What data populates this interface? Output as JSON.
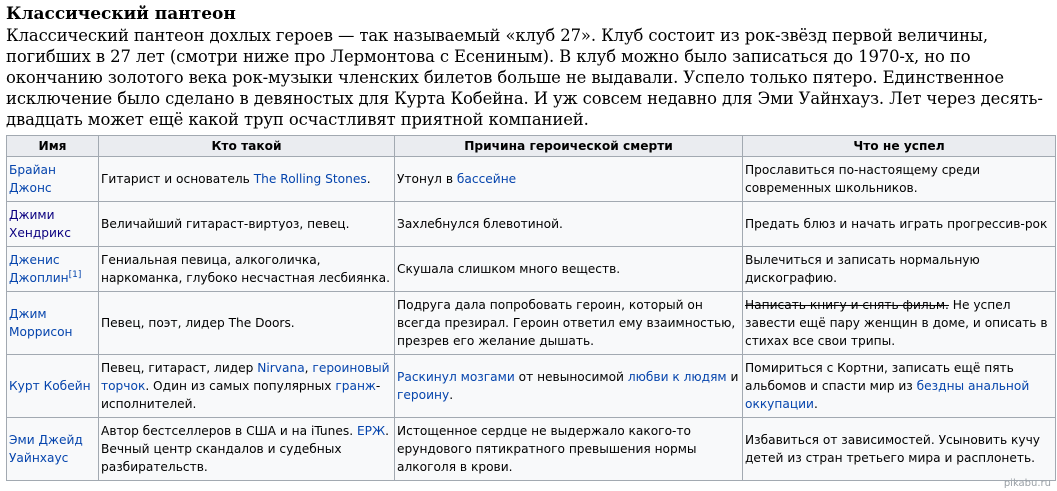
{
  "heading": "Классический пантеон",
  "intro": "Классический пантеон дохлых героев — так называемый «клуб 27». Клуб состоит из рок-звёзд первой величины, погибших в 27 лет (смотри ниже про Лермонтова с Есениным). В клуб можно было записаться до 1970-х, но по окончанию золотого века рок-музыки членских билетов больше не выдавали. Успело только пятеро. Единственное исключение было сделано в девяностых для Курта Кобейна. И уж совсем недавно для Эми Уайнхауз. Лет через десять-двадцать может ещё какой труп осчастливят приятной компанией.",
  "table": {
    "headers": [
      "Имя",
      "Кто такой",
      "Причина героической смерти",
      "Что не успел"
    ],
    "rows": [
      {
        "name": "Брайан Джонс",
        "who": {
          "t1": "Гитарист и основатель ",
          "l1": "The Rolling Stones",
          "t2": "."
        },
        "cause": {
          "t1": "Утонул в ",
          "l1": "бассейне"
        },
        "missed": "Прославиться по-настоящему среди современных школьников."
      },
      {
        "name": "Джими Хендрикс",
        "who": "Величайший гитараст-виртуоз, певец.",
        "cause": "Захлебнулся блевотиной.",
        "missed": "Предать блюз и начать играть прогрессив-рок"
      },
      {
        "name": "Дженис Джоплин",
        "name_ref": "[1]",
        "who": "Гениальная певица, алкоголичка, наркоманка, глубоко несчастная лесбиянка.",
        "cause": "Скушала слишком много веществ.",
        "missed": "Вылечиться и записать нормальную дискографию."
      },
      {
        "name": "Джим Моррисон",
        "who": "Певец, поэт, лидер The Doors.",
        "cause": "Подруга дала попробовать героин, который он всегда презирал. Героин ответил ему взаимностью, презрев его желание дышать.",
        "missed": {
          "strike": "Написать книгу и снять фильм.",
          "t1": " Не успел завести ещё пару женщин в доме, и описать в стихах все свои трипы."
        }
      },
      {
        "name": "Курт Кобейн",
        "who": {
          "t1": "Певец, гитараст, лидер ",
          "l1": "Nirvana",
          "t2": ", ",
          "l2": "героиновый торчок",
          "t3": ". Один из самых популярных ",
          "l3": "гранж",
          "t4": "-исполнителей."
        },
        "cause": {
          "l1": "Раскинул мозгами",
          "t1": " от невыносимой ",
          "l2": "любви к людям",
          "t2": " и ",
          "l3": "героину",
          "t3": "."
        },
        "missed": {
          "t1": "Помириться с Кортни, записать ещё пять альбомов и спасти мир из ",
          "l1": "бездны анальной оккупации",
          "t2": "."
        }
      },
      {
        "name": "Эми Джейд Уайнхаус",
        "who": {
          "t1": "Автор бестселлеров в США и на iTunes. ",
          "l1": "ЕРЖ",
          "t2": ". Вечный центр скандалов и судебных разбирательств."
        },
        "cause": "Истощенное сердце не выдержало какого-то ерундового пятикратного превышения нормы алкоголя в крови.",
        "missed": "Избавиться от зависимостей. Усыновить кучу детей из стран третьего мира и расплонеть."
      }
    ]
  },
  "watermark": "pikabu.ru",
  "colors": {
    "link": "#0645ad",
    "header_bg": "#eaecf0",
    "cell_bg": "#f8f9fa",
    "border": "#a2a9b1"
  }
}
